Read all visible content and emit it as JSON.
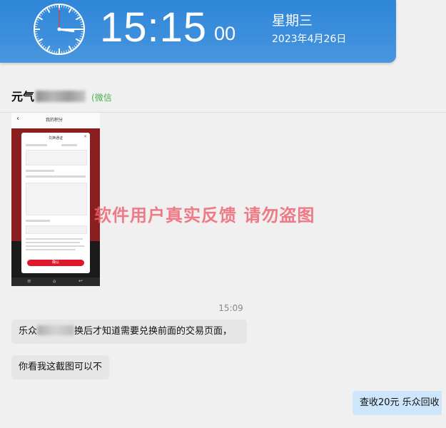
{
  "clock": {
    "time_hm": "15:15",
    "seconds": "00",
    "weekday": "星期三",
    "date": "2023年4月26日",
    "analog": {
      "hour": 15,
      "minute": 15,
      "second": 0
    }
  },
  "chat": {
    "title_prefix": "元气",
    "title_suffix": "(微信"
  },
  "shared_image": {
    "app_title": "我的积分",
    "dialog_title": "兑换通证",
    "confirm_label": "确认"
  },
  "watermark": "软件用户真实反馈  请勿盗图",
  "messages": {
    "time_divider": "15:09",
    "msg1_prefix": "乐众",
    "msg1_suffix": "换后才知道需要兑换前面的交易页面，",
    "msg2": "你看我这截图可以不",
    "msg3": "查收20元  乐众回收"
  },
  "colors": {
    "banner": "#3d8fdc",
    "watermark": "#ee5f6c",
    "outgoing_bubble": "#cde6fb",
    "incoming_bubble": "#e6e6e6"
  }
}
